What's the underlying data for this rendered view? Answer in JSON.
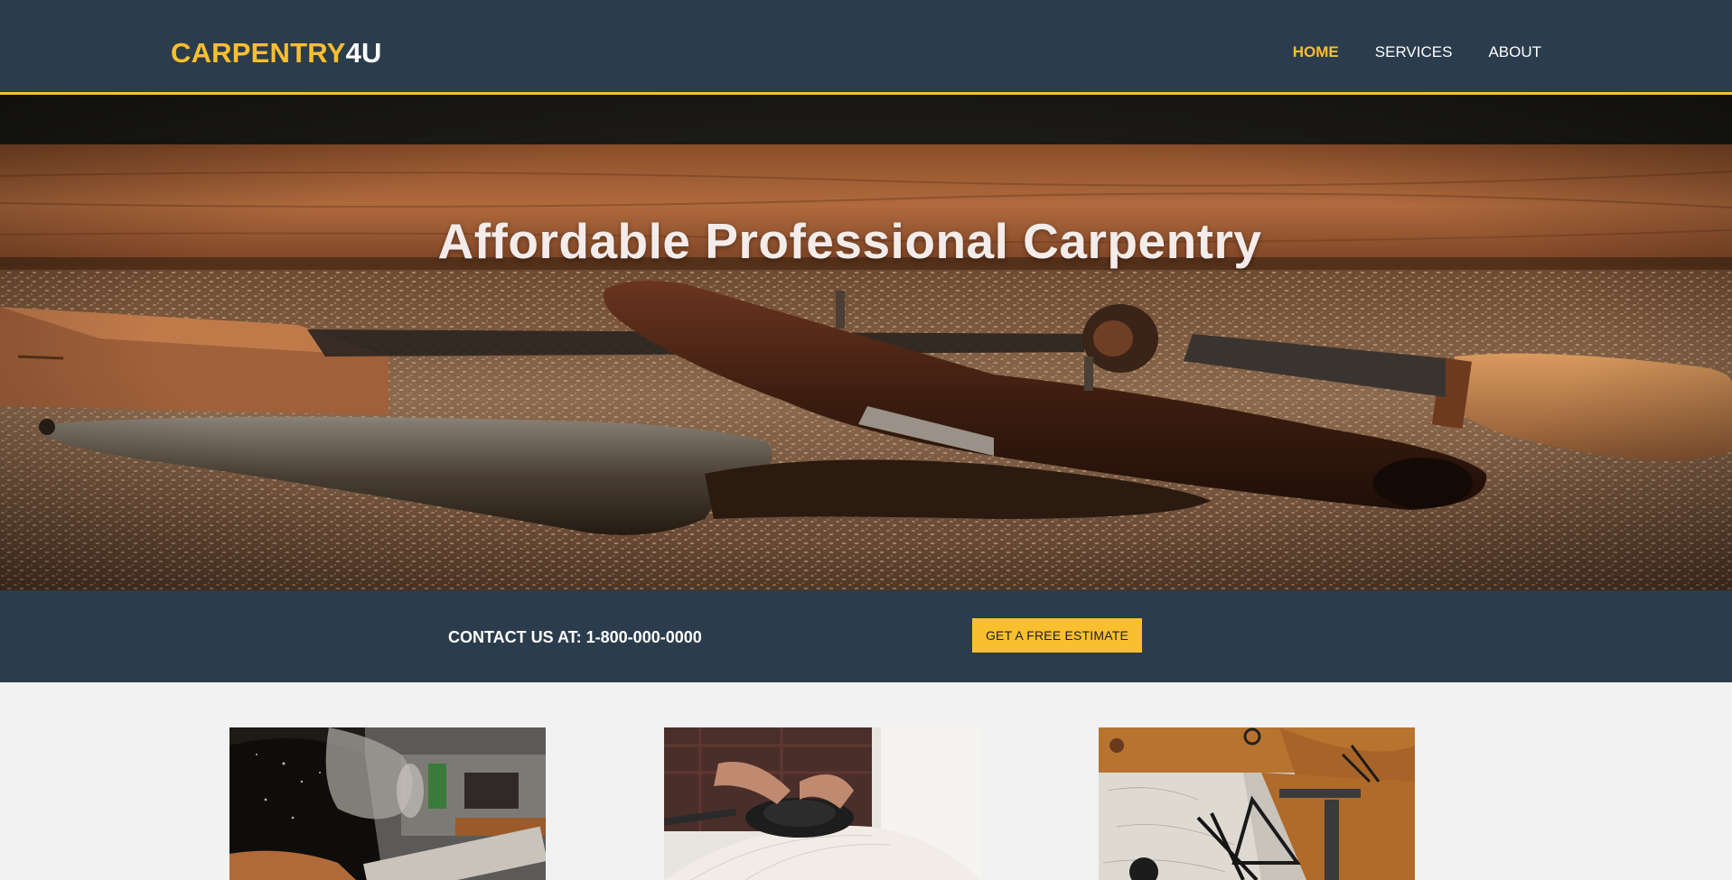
{
  "header": {
    "logo_brand": "CARPENTRY",
    "logo_suffix": "4U",
    "nav": [
      {
        "label": "HOME",
        "active": true
      },
      {
        "label": "SERVICES",
        "active": false
      },
      {
        "label": "ABOUT",
        "active": false
      }
    ]
  },
  "hero": {
    "title": "Affordable Professional Carpentry",
    "image": "vintage-woodworking-tools-on-sawdust-photo"
  },
  "contact": {
    "text": "CONTACT US AT: 1-800-000-0000",
    "button_label": "GET A FREE ESTIMATE"
  },
  "cards": [
    {
      "image": "woodworker-with-face-shield-photo"
    },
    {
      "image": "carpenter-using-orbital-sander-photo"
    },
    {
      "image": "drafting-tools-on-plans-photo"
    }
  ],
  "colors": {
    "primary_dark": "#2b3c4d",
    "accent": "#f9bf2e",
    "page_background": "#f2f2f2",
    "white": "#ffffff"
  }
}
